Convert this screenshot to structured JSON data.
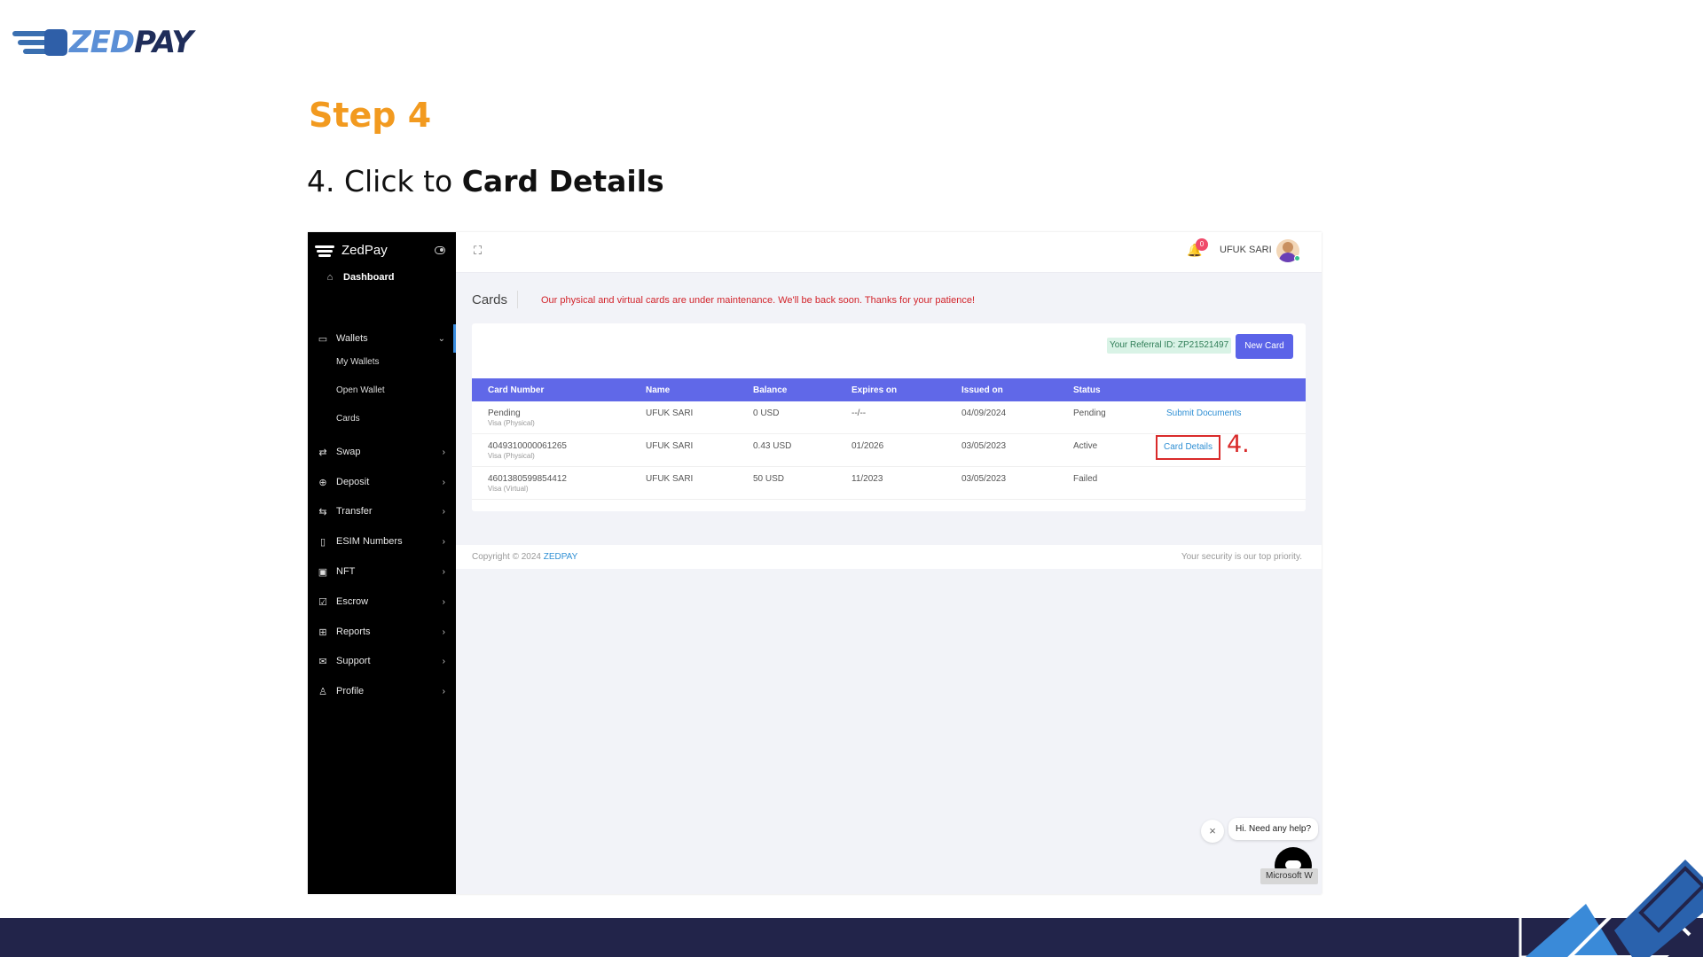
{
  "logo": {
    "zed": "ZED",
    "pay": "PAY"
  },
  "step_title": "Step 4",
  "instruction": {
    "prefix": "4. Click to ",
    "bold": "Card Details"
  },
  "app": {
    "brand": "ZedPay",
    "sidebar": {
      "dashboard": "Dashboard",
      "wallets": "Wallets",
      "wallet_sub": [
        "My Wallets",
        "Open Wallet",
        "Cards"
      ],
      "items": [
        "Swap",
        "Deposit",
        "Transfer",
        "ESIM Numbers",
        "NFT",
        "Escrow",
        "Reports",
        "Support",
        "Profile"
      ]
    },
    "topbar": {
      "notification_count": "0",
      "user_name": "UFUK SARI"
    },
    "page_title": "Cards",
    "maintenance_message": "Our physical and virtual cards are under maintenance. We'll be back soon. Thanks for your patience!",
    "referral": "Your Referral ID: ZP21521497",
    "new_card_label": "New Card",
    "table": {
      "columns": [
        "Card Number",
        "Name",
        "Balance",
        "Expires on",
        "Issued on",
        "Status"
      ],
      "rows": [
        {
          "card_number": "Pending",
          "card_type": "Visa (Physical)",
          "name": "UFUK SARI",
          "balance": "0 USD",
          "expires": "--/--",
          "issued": "04/09/2024",
          "status": "Pending",
          "action": "Submit Documents"
        },
        {
          "card_number": "4049310000061265",
          "card_type": "Visa (Physical)",
          "name": "UFUK SARI",
          "balance": "0.43 USD",
          "expires": "01/2026",
          "issued": "03/05/2023",
          "status": "Active",
          "action": "Card Details"
        },
        {
          "card_number": "4601380599854412",
          "card_type": "Visa (Virtual)",
          "name": "UFUK SARI",
          "balance": "50 USD",
          "expires": "11/2023",
          "issued": "03/05/2023",
          "status": "Failed",
          "action": ""
        }
      ]
    },
    "annotation": "4.",
    "footer": {
      "copyright_prefix": "Copyright © 2024 ",
      "copyright_brand": "ZEDPAY",
      "security": "Your security is our top priority."
    },
    "chat": {
      "close": "×",
      "greeting": "Hi. Need any help?",
      "tooltip": "Microsoft W"
    }
  },
  "colors": {
    "accent_orange": "#f29a1f",
    "table_header": "#6068e8",
    "link": "#2f8fd4",
    "highlight_red": "#d92a2a",
    "bottom_bar": "#22244a"
  }
}
